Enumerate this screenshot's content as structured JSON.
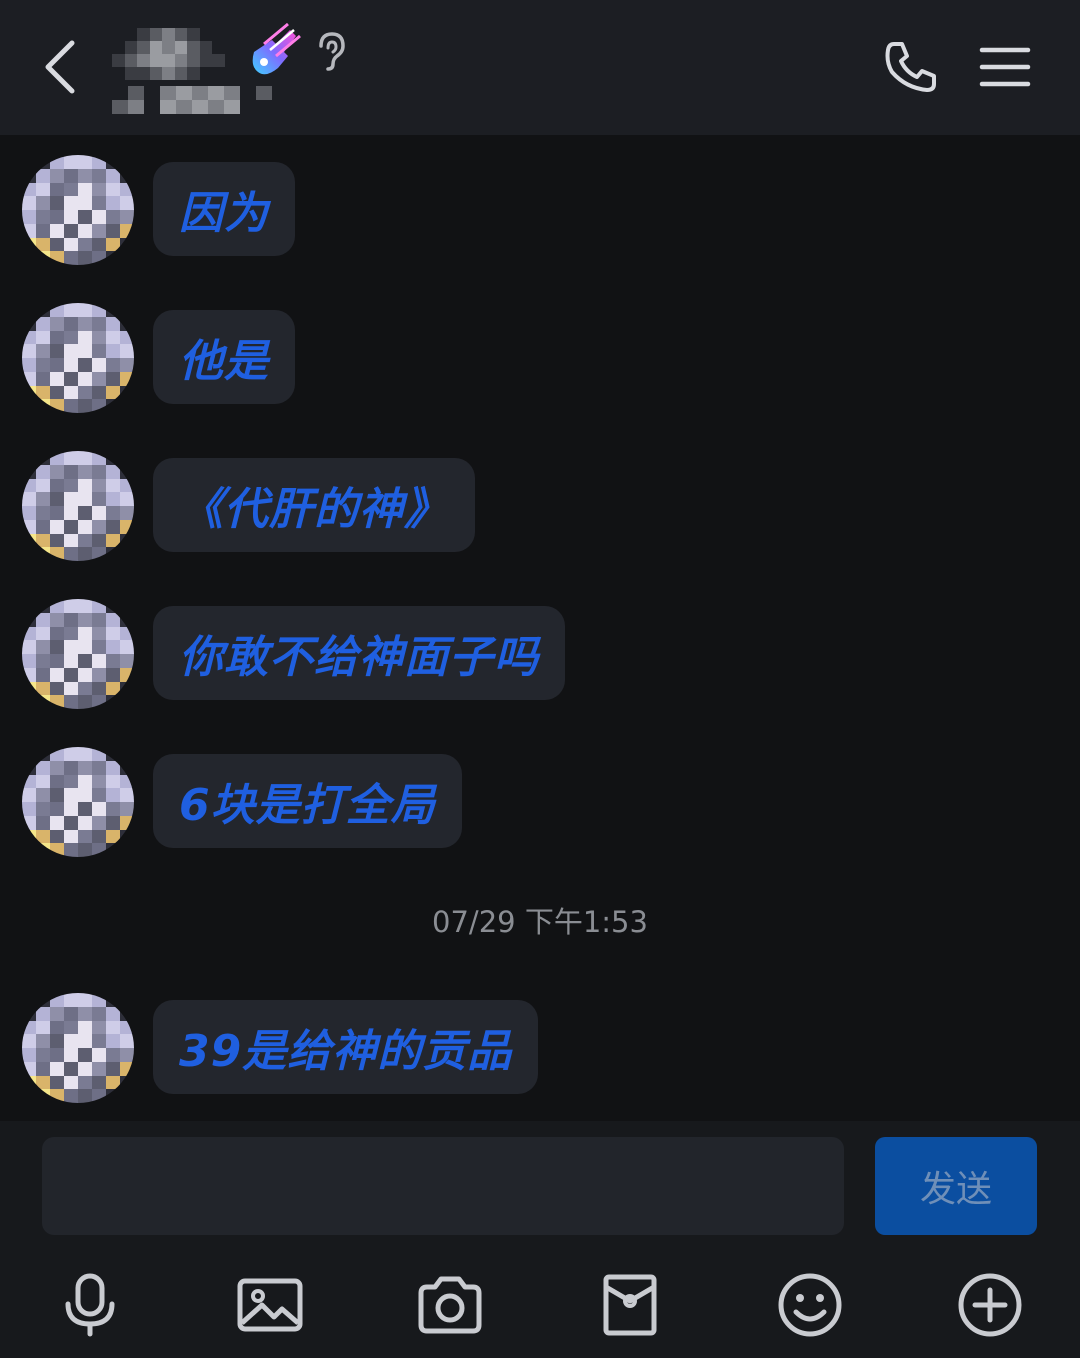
{
  "header": {
    "back_icon": "chevron-left-icon",
    "badge_icon": "guitar-badge-icon",
    "status_icon": "ear-icon",
    "call_icon": "phone-icon",
    "menu_icon": "hamburger-menu-icon"
  },
  "messages": [
    {
      "text": "因为"
    },
    {
      "text": "他是"
    },
    {
      "text": "《代肝的神》"
    },
    {
      "text": "你敢不给神面子吗"
    },
    {
      "text": "6块是打全局"
    },
    {
      "text": "39是给神的贡品"
    }
  ],
  "timestamp": "07/29 下午1:53",
  "input": {
    "value": "",
    "send_label": "发送"
  },
  "toolbar": {
    "icons": [
      "microphone-icon",
      "image-icon",
      "camera-icon",
      "red-packet-icon",
      "emoji-icon",
      "plus-icon"
    ]
  },
  "colors": {
    "background": "#111214",
    "header": "#1c1e23",
    "bubble": "#23262d",
    "message_text": "#1f5fe0",
    "send_button": "#0b4ea0"
  }
}
